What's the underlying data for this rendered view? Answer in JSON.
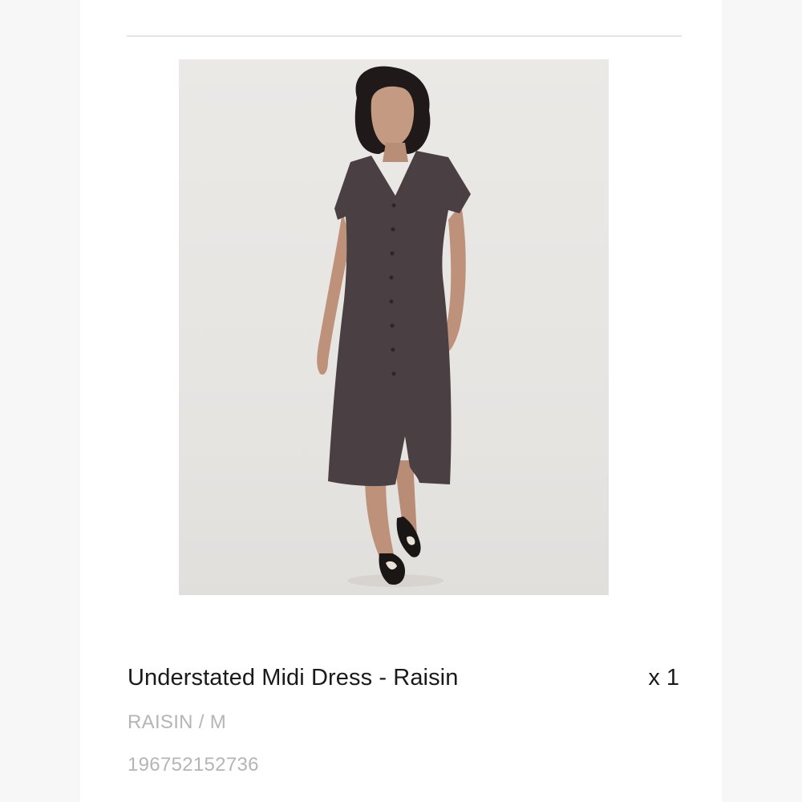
{
  "line_item": {
    "image_alt": "Understated Midi Dress - Raisin",
    "title": "Understated Midi Dress - Raisin",
    "quantity": "x 1",
    "variant": "RAISIN / M",
    "sku": "196752152736",
    "colors": {
      "title": "#1a1a1a",
      "meta": "#b5b5b5",
      "dress": "#4a3f42"
    }
  }
}
